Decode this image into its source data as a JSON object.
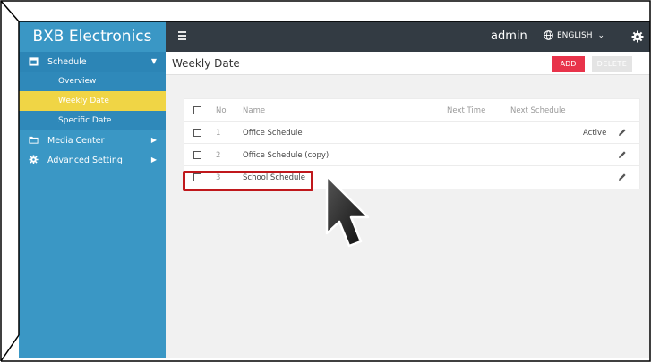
{
  "brand": {
    "name": "BXB Electronics"
  },
  "header": {
    "user": "admin",
    "language": "ENGLISH"
  },
  "sidebar": {
    "items": [
      {
        "label": "Schedule",
        "icon": "calendar-icon"
      },
      {
        "label": "Overview"
      },
      {
        "label": "Weekly Date"
      },
      {
        "label": "Specific Date"
      },
      {
        "label": "Media Center",
        "icon": "folder-icon"
      },
      {
        "label": "Advanced Setting",
        "icon": "gear-icon"
      }
    ]
  },
  "page": {
    "title": "Weekly Date",
    "add_label": "ADD",
    "delete_label": "DELETE"
  },
  "table": {
    "columns": [
      "No",
      "Name",
      "Next Time",
      "Next Schedule"
    ],
    "rows": [
      {
        "no": "1",
        "name": "Office Schedule",
        "status": "Active"
      },
      {
        "no": "2",
        "name": "Office Schedule (copy)",
        "status": ""
      },
      {
        "no": "3",
        "name": "School Schedule",
        "status": ""
      }
    ]
  },
  "colors": {
    "sidebar": "#3a97c5",
    "topbar": "#333b43",
    "active_item": "#f0d545",
    "add_button": "#e8334a",
    "highlight": "#c0181c"
  }
}
